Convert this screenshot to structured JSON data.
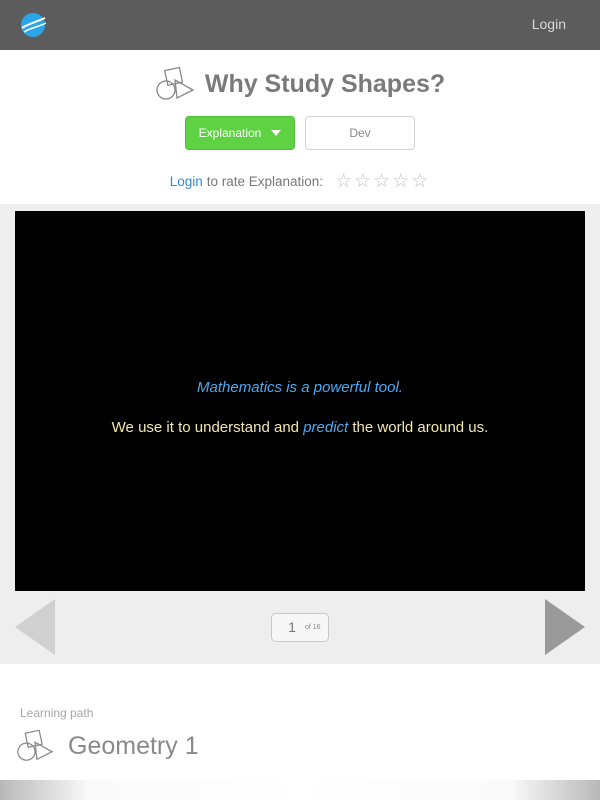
{
  "nav": {
    "login_label": "Login",
    "logo_icon": "brand-globe-icon"
  },
  "lesson": {
    "title": "Why Study Shapes?",
    "icon": "geometry-shapes-icon",
    "dropdown_label": "Explanation",
    "dev_label": "Dev",
    "rate": {
      "login_link": "Login",
      "text": "to rate Explanation:",
      "stars": [
        "☆",
        "☆",
        "☆",
        "☆",
        "☆"
      ],
      "rating": 0,
      "max_rating": 5
    }
  },
  "slide": {
    "line1": "Mathematics is a powerful tool.",
    "line2_before": "We use it to understand and ",
    "line2_emphasis": "predict",
    "line2_after": " the world around us."
  },
  "pager": {
    "current_page": "1",
    "of_text": "of 16"
  },
  "learning_path": {
    "label": "Learning path",
    "title": "Geometry 1",
    "icon": "geometry-shapes-icon"
  },
  "colors": {
    "topbar": "#5c5c5c",
    "accent_green": "#5ed243",
    "link_blue": "#2c8bd8",
    "slide_bg": "#000000",
    "slide_blue": "#4da9f0",
    "slide_cream": "#f3e7b2"
  }
}
